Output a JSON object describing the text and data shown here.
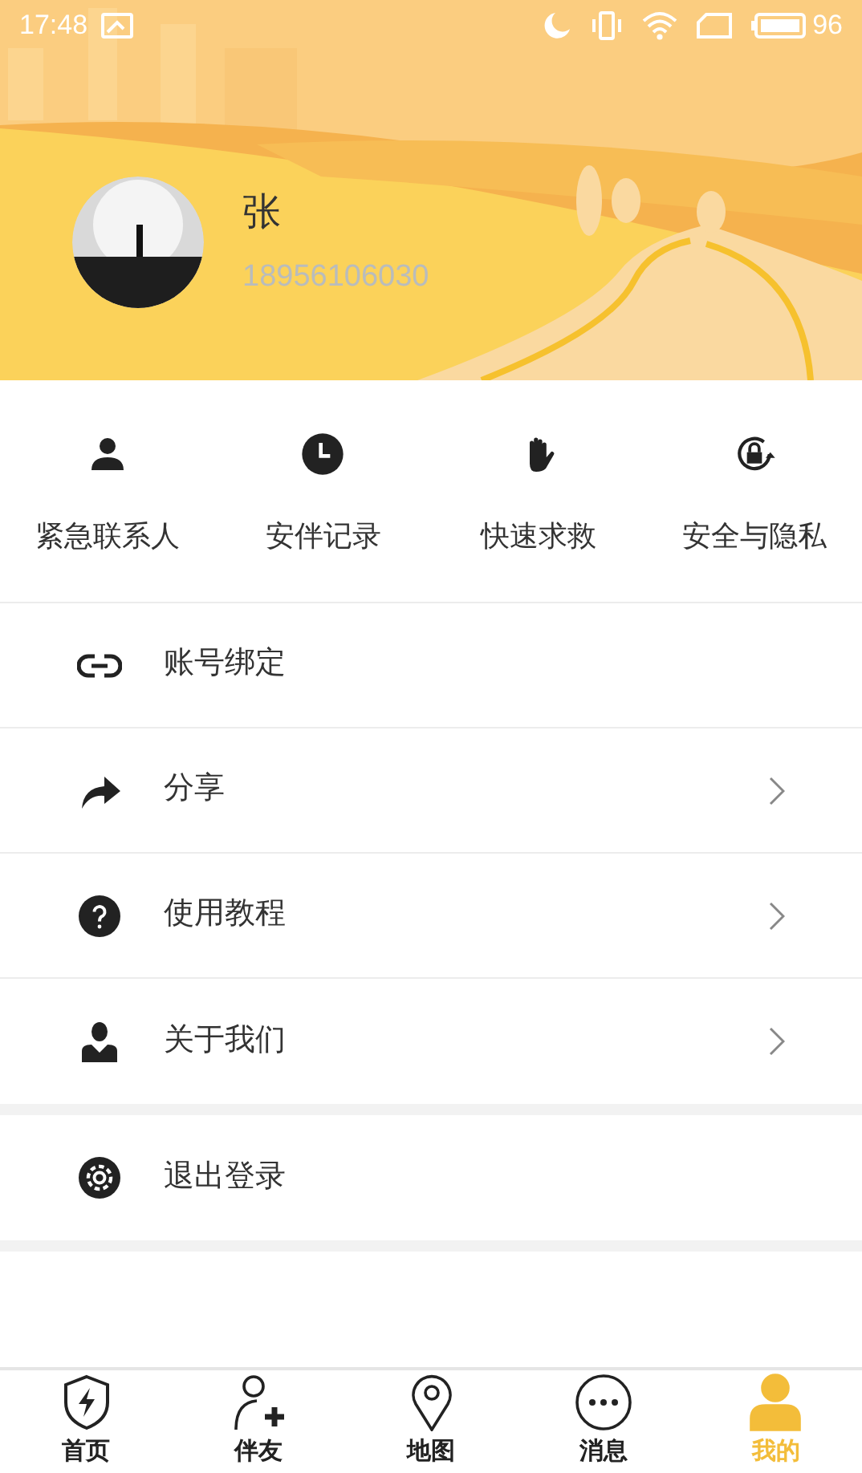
{
  "status_bar": {
    "time": "17:48",
    "battery": "96"
  },
  "profile": {
    "name": "张",
    "phone": "18956106030"
  },
  "quick_actions": [
    {
      "label": "紧急联系人"
    },
    {
      "label": "安伴记录"
    },
    {
      "label": "快速求救"
    },
    {
      "label": "安全与隐私"
    }
  ],
  "menu_groups": [
    [
      {
        "label": "账号绑定",
        "chevron": false
      },
      {
        "label": "分享",
        "chevron": true
      },
      {
        "label": "使用教程",
        "chevron": true
      },
      {
        "label": "关于我们",
        "chevron": true
      }
    ],
    [
      {
        "label": "退出登录",
        "chevron": false
      }
    ]
  ],
  "tabs": [
    {
      "label": "首页",
      "selected": false
    },
    {
      "label": "伴友",
      "selected": false
    },
    {
      "label": "地图",
      "selected": false
    },
    {
      "label": "消息",
      "selected": false
    },
    {
      "label": "我的",
      "selected": true
    }
  ]
}
